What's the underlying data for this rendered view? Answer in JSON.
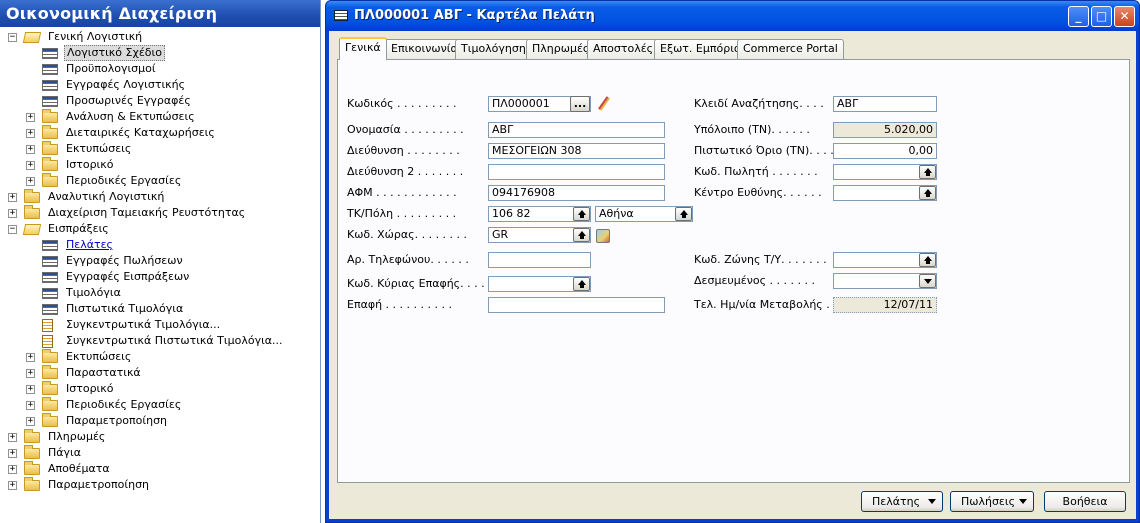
{
  "nav": {
    "title": "Οικονομική Διαχείριση",
    "tree": [
      {
        "label": "Γενική Λογιστική",
        "icon": "folder-open-icon",
        "expander": "−"
      },
      {
        "label": "Λογιστικό Σχέδιο",
        "icon": "form-icon",
        "selected": true
      },
      {
        "label": "Προϋπολογισμοί",
        "icon": "form-icon"
      },
      {
        "label": "Εγγραφές Λογιστικής",
        "icon": "form-icon"
      },
      {
        "label": "Προσωρινές Εγγραφές",
        "icon": "form-icon"
      },
      {
        "label": "Ανάλυση & Εκτυπώσεις",
        "icon": "folder-icon",
        "expander": "+"
      },
      {
        "label": "Διεταιρικές Καταχωρήσεις",
        "icon": "folder-icon",
        "expander": "+"
      },
      {
        "label": "Εκτυπώσεις",
        "icon": "folder-icon",
        "expander": "+"
      },
      {
        "label": "Ιστορικό",
        "icon": "folder-icon",
        "expander": "+"
      },
      {
        "label": "Περιοδικές Εργασίες",
        "icon": "folder-icon",
        "expander": "+"
      },
      {
        "label": "Αναλυτική Λογιστική",
        "icon": "folder-icon",
        "expander": "+"
      },
      {
        "label": "Διαχείριση Ταμειακής Ρευστότητας",
        "icon": "folder-icon",
        "expander": "+"
      },
      {
        "label": "Εισπράξεις",
        "icon": "folder-open-icon",
        "expander": "−"
      },
      {
        "label": "Πελάτες",
        "icon": "form-icon",
        "current": true
      },
      {
        "label": "Εγγραφές Πωλήσεων",
        "icon": "form-icon"
      },
      {
        "label": "Εγγραφές Εισπράξεων",
        "icon": "form-icon"
      },
      {
        "label": "Τιμολόγια",
        "icon": "form-icon"
      },
      {
        "label": "Πιστωτικά Τιμολόγια",
        "icon": "form-icon"
      },
      {
        "label": "Συγκεντρωτικά Τιμολόγια...",
        "icon": "report-icon"
      },
      {
        "label": "Συγκεντρωτικά Πιστωτικά Τιμολόγια...",
        "icon": "report-icon"
      },
      {
        "label": "Εκτυπώσεις",
        "icon": "folder-icon",
        "expander": "+"
      },
      {
        "label": "Παραστατικά",
        "icon": "folder-icon",
        "expander": "+"
      },
      {
        "label": "Ιστορικό",
        "icon": "folder-icon",
        "expander": "+"
      },
      {
        "label": "Περιοδικές Εργασίες",
        "icon": "folder-icon",
        "expander": "+"
      },
      {
        "label": "Παραμετροποίηση",
        "icon": "folder-icon",
        "expander": "+"
      },
      {
        "label": "Πληρωμές",
        "icon": "folder-icon",
        "expander": "+"
      },
      {
        "label": "Πάγια",
        "icon": "folder-icon",
        "expander": "+"
      },
      {
        "label": "Αποθέματα",
        "icon": "folder-icon",
        "expander": "+"
      },
      {
        "label": "Παραμετροποίηση",
        "icon": "folder-icon",
        "expander": "+"
      }
    ]
  },
  "window": {
    "title": "ΠΛ000001 ΑΒΓ - Καρτέλα Πελάτη",
    "controls": {
      "minimize": "_",
      "maximize": "□",
      "close": "✕"
    },
    "tabs": [
      "Γενικά",
      "Επικοινωνία",
      "Τιμολόγηση",
      "Πληρωμές",
      "Αποστολές",
      "Εξωτ. Εμπόριο",
      "Commerce Portal"
    ],
    "active_tab": "Γενικά"
  },
  "form": {
    "code_label": "Κωδικός . . . . . . . . .",
    "code_value": "ΠΛ000001",
    "assist_label": "...",
    "name_label": "Ονομασία . . . . . . . . .",
    "name_value": "ΑΒΓ",
    "address_label": "Διεύθυνση . . . . . . . .",
    "address_value": "ΜΕΣΟΓΕΙΩΝ 308",
    "address2_label": "Διεύθυνση 2 . . . . . . .",
    "address2_value": "",
    "vat_label": "ΑΦΜ . . . . . . . . . . . .",
    "vat_value": "094176908",
    "postcode_label": "ΤΚ/Πόλη . . . . . . . . .",
    "postcode_value": "106 82",
    "city_value": "Αθήνα",
    "country_label": "Κωδ. Χώρας. . . . . . . .",
    "country_value": "GR",
    "phone_label": "Αρ. Τηλεφώνου. . . . . .",
    "phone_value": "",
    "contact_code_label": "Κωδ. Κύριας Επαφής. . . .",
    "contact_code_value": "",
    "contact_label": "Επαφή . . . . . . . . . .",
    "contact_value": "",
    "search_key_label": "Κλειδί Αναζήτησης. . . .",
    "search_key_value": "ΑΒΓ",
    "balance_label": "Υπόλοιπο (ΤΝ). . . . . .",
    "balance_value": "5.020,00",
    "credit_limit_label": "Πιστωτικό Όριο (ΤΝ). . . .",
    "credit_limit_value": "0,00",
    "salesperson_label": "Κωδ. Πωλητή . . . . . . .",
    "salesperson_value": "",
    "responsibility_label": "Κέντρο Ευθύνης. . . . . .",
    "responsibility_value": "",
    "zone_label": "Κωδ. Ζώνης Τ/Υ. . . . . . .",
    "zone_value": "",
    "blocked_label": "Δεσμευμένος . . . . . . .",
    "blocked_value": "",
    "modified_label": "Τελ. Ημ/νία Μεταβολής . .",
    "modified_value": "12/07/11"
  },
  "buttons": {
    "customer": "Πελάτης",
    "sales": "Πωλήσεις",
    "help": "Βοήθεια"
  },
  "colors": {
    "nav_header": "#1e4fb0",
    "titlebar": "#0052e0",
    "client_bg": "#ece9d8",
    "field_border": "#7f9db9"
  }
}
